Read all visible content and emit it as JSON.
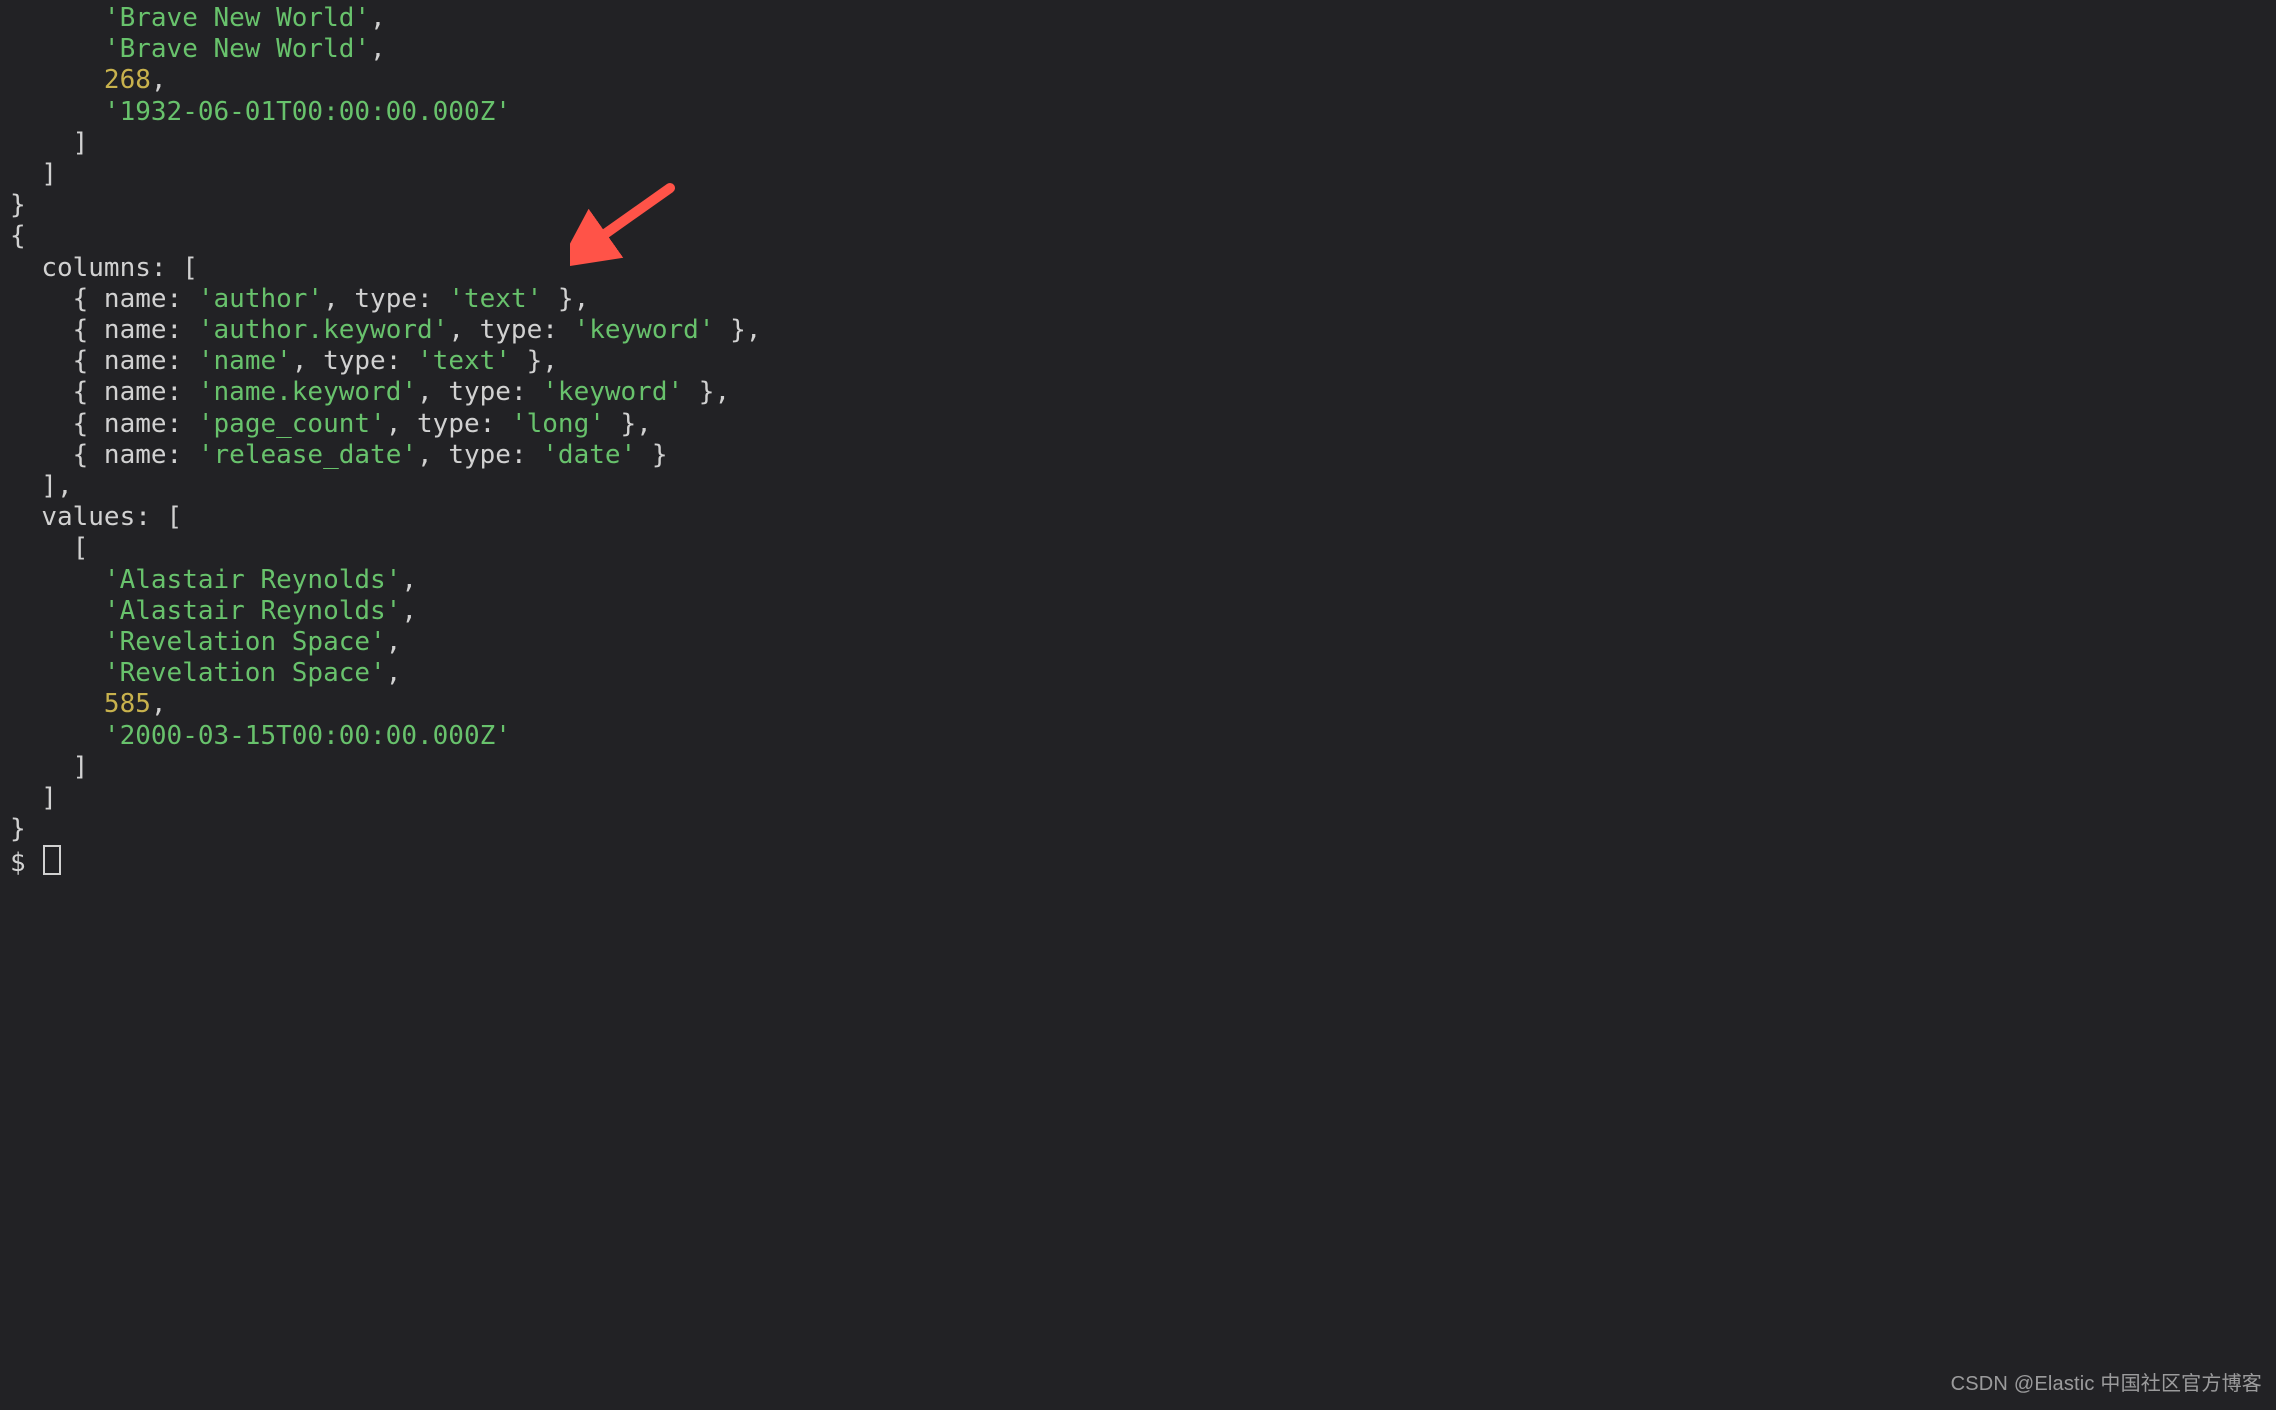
{
  "terminal": {
    "top_snippet": {
      "lines": [
        {
          "indent": 6,
          "type": "string",
          "text": "'Brave New World'",
          "trail": ","
        },
        {
          "indent": 6,
          "type": "string",
          "text": "'Brave New World'",
          "trail": ","
        },
        {
          "indent": 6,
          "type": "number",
          "text": "268",
          "trail": ","
        },
        {
          "indent": 6,
          "type": "string",
          "text": "'1932-06-01T00:00:00.000Z'",
          "trail": ""
        },
        {
          "indent": 4,
          "type": "plain",
          "text": "]",
          "trail": ""
        },
        {
          "indent": 2,
          "type": "plain",
          "text": "]",
          "trail": ""
        },
        {
          "indent": 0,
          "type": "plain",
          "text": "}",
          "trail": ""
        }
      ]
    },
    "object": {
      "columns_label": "columns",
      "values_label": "values",
      "name_key": "name",
      "type_key": "type",
      "columns": [
        {
          "name": "'author'",
          "type": "'text'"
        },
        {
          "name": "'author.keyword'",
          "type": "'keyword'"
        },
        {
          "name": "'name'",
          "type": "'text'"
        },
        {
          "name": "'name.keyword'",
          "type": "'keyword'"
        },
        {
          "name": "'page_count'",
          "type": "'long'"
        },
        {
          "name": "'release_date'",
          "type": "'date'"
        }
      ],
      "values_row": [
        {
          "type": "string",
          "text": "'Alastair Reynolds'"
        },
        {
          "type": "string",
          "text": "'Alastair Reynolds'"
        },
        {
          "type": "string",
          "text": "'Revelation Space'"
        },
        {
          "type": "string",
          "text": "'Revelation Space'"
        },
        {
          "type": "number",
          "text": "585"
        },
        {
          "type": "string",
          "text": "'2000-03-15T00:00:00.000Z'"
        }
      ]
    },
    "prompt": "$"
  },
  "annotation": {
    "arrow_color": "#ff5348"
  },
  "watermark": "CSDN @Elastic 中国社区官方博客"
}
